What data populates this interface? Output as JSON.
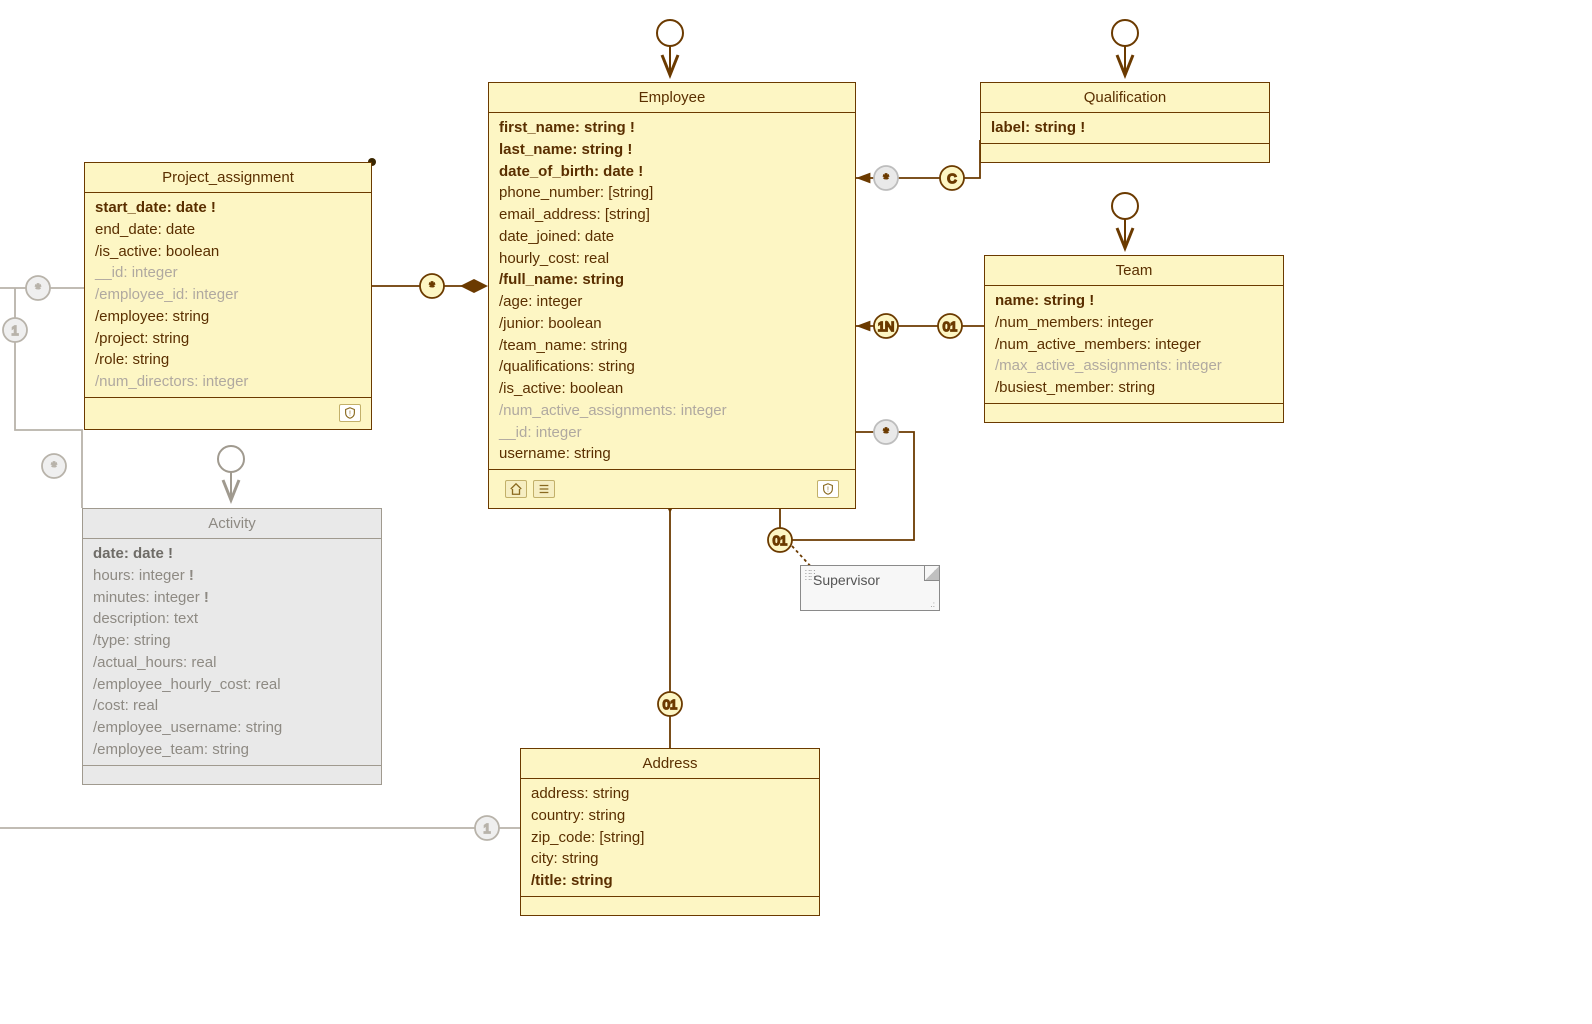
{
  "classes": {
    "employee": {
      "title": "Employee",
      "attrs": [
        {
          "t": "first_name: string",
          "bold": true,
          "mark": "!"
        },
        {
          "t": "last_name: string",
          "bold": true,
          "mark": "!"
        },
        {
          "t": "date_of_birth: date",
          "bold": true,
          "mark": "!"
        },
        {
          "t": "phone_number: [string]"
        },
        {
          "t": "email_address: [string]"
        },
        {
          "t": "date_joined: date"
        },
        {
          "t": "hourly_cost: real"
        },
        {
          "t": "/full_name: string",
          "bold": true
        },
        {
          "t": "/age: integer"
        },
        {
          "t": "/junior: boolean"
        },
        {
          "t": "/team_name: string"
        },
        {
          "t": "/qualifications: string"
        },
        {
          "t": "/is_active: boolean"
        },
        {
          "t": "/num_active_assignments: integer",
          "muted": true
        },
        {
          "t": "__id: integer",
          "muted": true
        },
        {
          "t": "username: string"
        }
      ]
    },
    "qualification": {
      "title": "Qualification",
      "attrs": [
        {
          "t": "label: string",
          "bold": true,
          "mark": "!"
        }
      ]
    },
    "team": {
      "title": "Team",
      "attrs": [
        {
          "t": "name: string",
          "bold": true,
          "mark": "!"
        },
        {
          "t": "/num_members: integer"
        },
        {
          "t": "/num_active_members: integer"
        },
        {
          "t": "/max_active_assignments: integer",
          "muted": true
        },
        {
          "t": "/busiest_member: string"
        }
      ]
    },
    "project_assignment": {
      "title": "Project_assignment",
      "attrs": [
        {
          "t": "start_date: date",
          "bold": true,
          "mark": "!"
        },
        {
          "t": "end_date: date"
        },
        {
          "t": "/is_active: boolean"
        },
        {
          "t": "__id: integer",
          "muted": true
        },
        {
          "t": "/employee_id: integer",
          "muted": true
        },
        {
          "t": "/employee: string"
        },
        {
          "t": "/project: string"
        },
        {
          "t": "/role: string"
        },
        {
          "t": "/num_directors: integer",
          "muted": true
        }
      ]
    },
    "activity": {
      "title": "Activity",
      "attrs": [
        {
          "t": "date: date",
          "bold": true,
          "mark": "!"
        },
        {
          "t": "hours: integer",
          "mark": "!"
        },
        {
          "t": "minutes: integer",
          "mark": "!"
        },
        {
          "t": "description: text"
        },
        {
          "t": "/type: string"
        },
        {
          "t": "/actual_hours: real"
        },
        {
          "t": "/employee_hourly_cost: real"
        },
        {
          "t": "/cost: real"
        },
        {
          "t": "/employee_username: string"
        },
        {
          "t": "/employee_team: string"
        }
      ]
    },
    "address": {
      "title": "Address",
      "attrs": [
        {
          "t": "address: string"
        },
        {
          "t": "country: string"
        },
        {
          "t": "zip_code: [string]"
        },
        {
          "t": "city: string"
        },
        {
          "t": "/title: string",
          "bold": true
        }
      ]
    }
  },
  "note_supervisor": "Supervisor",
  "multiplicities": {
    "pa_star": "*",
    "emp_qual_star": "*",
    "emp_qual_C": "C",
    "emp_team_1N": "1N",
    "emp_team_01": "01",
    "emp_sup_star": "*",
    "emp_sup_01": "01",
    "emp_addr_01": "01",
    "left_star_top": "*",
    "left_1": "1",
    "left_star_mid": "*",
    "left_addr_1": "1"
  }
}
